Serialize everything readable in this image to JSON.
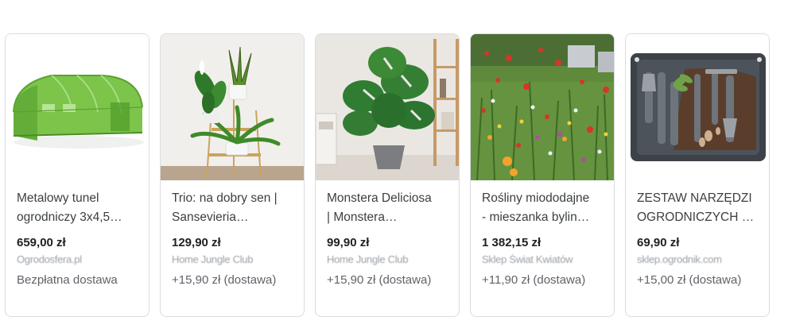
{
  "cards": [
    {
      "image": "greenhouse-tunnel-image",
      "title": "Metalowy tunel\nogrodniczy 3x4,5…",
      "price": "659,00 zł",
      "merchant": "Ogrodosfera.pl",
      "shipping": "Bezpłatna dostawa"
    },
    {
      "image": "plant-trio-stand-image",
      "title": "Trio: na dobry sen |\nSansevieria…",
      "price": "129,90 zł",
      "merchant": "Home Jungle Club",
      "shipping": "+15,90 zł (dostawa)"
    },
    {
      "image": "monstera-pot-image",
      "title": "Monstera Deliciosa\n| Monstera…",
      "price": "99,90 zł",
      "merchant": "Home Jungle Club",
      "shipping": "+15,90 zł (dostawa)"
    },
    {
      "image": "wildflower-meadow-image",
      "title": "Rośliny miododajne\n- mieszanka bylin…",
      "price": "1 382,15 zł",
      "merchant": "Sklep Świat Kwiatów",
      "shipping": "+11,90 zł (dostawa)"
    },
    {
      "image": "garden-tools-tray-image",
      "title": "ZESTAW NARZĘDZI\nOGRODNICZYCH …",
      "price": "69,90 zł",
      "merchant": "sklep.ogrodnik.com",
      "shipping": "+15,00 zł (dostawa)"
    }
  ]
}
